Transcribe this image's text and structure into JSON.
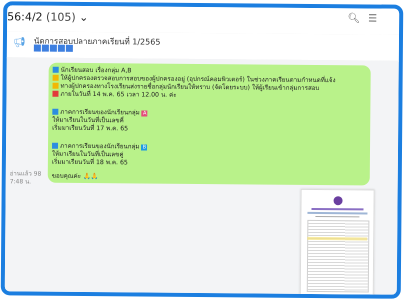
{
  "header": {
    "title": "56:4/2",
    "count": "(105)",
    "icons": [
      "volume-icon",
      "search-icon",
      "menu-icon"
    ]
  },
  "pinned": {
    "text": "นัดการสอบปลายภาคเรียนที่ 1/2565"
  },
  "message": {
    "lines": [
      "นักเรียนสอบ เรื่องกลุ่ม A,B",
      "ให้ผู้ปกครองตรวจสอบการสอบของผู้ปกครองอยู่ (อุปกรณ์คอมพิวเตอร์) ในช่วงภาคเรียนตามกำหนดที่แจ้ง",
      "ทางผู้ปกครองทางโรงเรียนส่งรายชื่อกลุ่มนักเรียนให้ทราบ (จัดโดยระบบ) ให้ผู้เรียนเข้ากลุ่มการสอบ",
      "ภายในวันที่ 14 พ.ค. 65 เวลา 12.00 น. ค่ะ",
      "ภาคการเรียนของนักเรียนกลุ่ม",
      "ให้มาเรียนในวันที่เป็นเลขคี่",
      "เริ่มมาเรียนวันที่ 17 พ.ค. 65",
      "ภาคการเรียนของนักเรียนกลุ่ม",
      "ให้มาเรียนในวันที่เป็นเลขคู่",
      "เริ่มมาเรียนวันที่ 18 พ.ค. 65",
      "ขอบคุณค่ะ"
    ],
    "group_a": "A",
    "group_b": "B",
    "timestamp": [
      "อ่านแล้ว 98",
      "7:48 น."
    ]
  },
  "colors": {
    "accent": "#1b7ee0",
    "bubble": "#b9f28a"
  }
}
